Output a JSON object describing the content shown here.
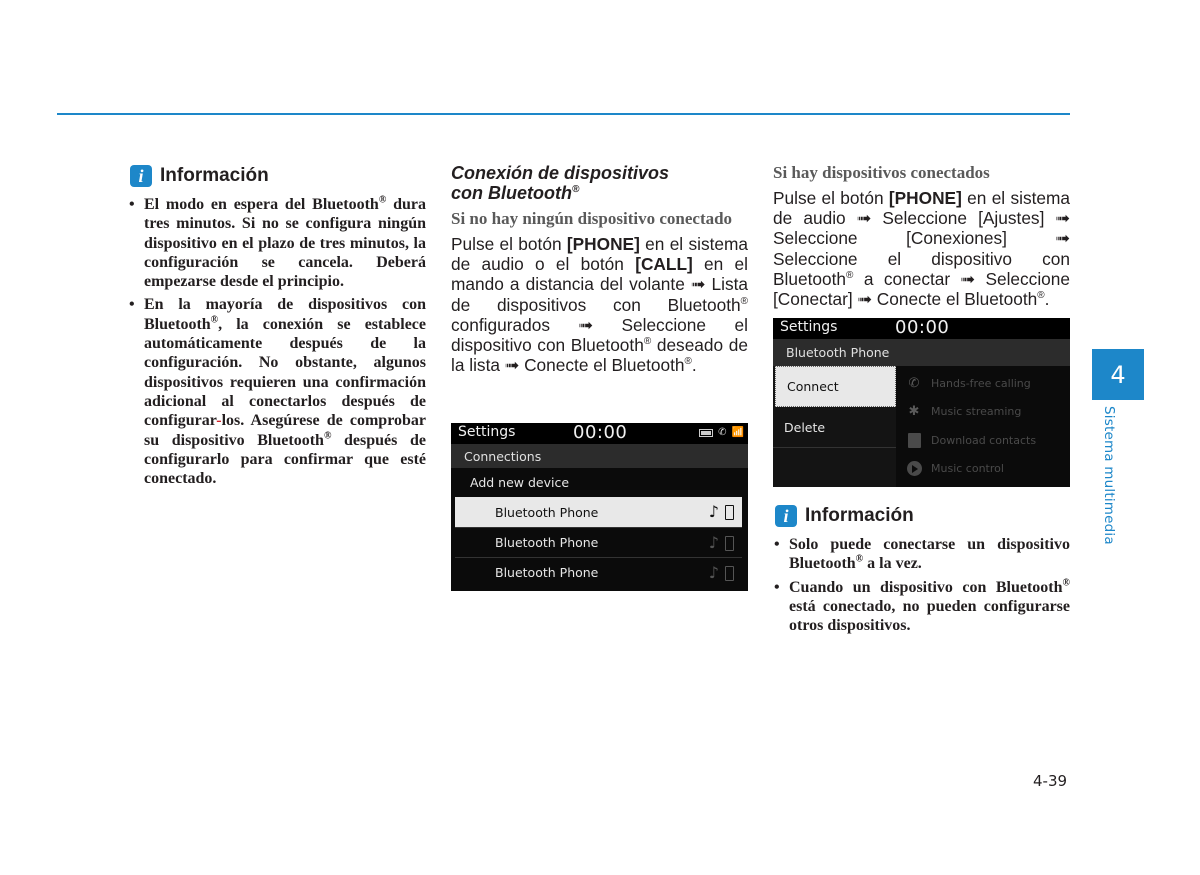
{
  "page": {
    "page_number": "4-39",
    "chapter_number": "4",
    "chapter_title": "Sistema multimedia",
    "accent_color": "#1d87c9"
  },
  "column1": {
    "info_title": "Información",
    "bullets": [
      {
        "parts": [
          "El modo en espera del Bluetooth",
          "®",
          " dura tres minutos. Si no se configura ningún dispositivo en el plazo de tres minutos, la configuración se cancela. Deberá empezarse desde el principio."
        ]
      },
      {
        "parts": [
          "En la mayoría de dispositivos con Bluetooth",
          "®",
          ", la conexión se establece automáticamente después de la configuración. No obstante, algunos dispositivos requieren una confirmación adicional al conectarlos después de configurar",
          "-",
          "los. Asegúrese de comprobar su dispositivo Bluetooth",
          "®",
          " después de configurarlo para confirmar que esté conectado."
        ]
      }
    ]
  },
  "column2": {
    "section_title_line1": "Conexión de dispositivos",
    "section_title_line2": "con Bluetooth",
    "section_title_sup": "®",
    "subtitle": "Si no hay ningún dispositivo conectado",
    "body": {
      "t1": "Pulse el botón ",
      "b1": "[PHONE]",
      "t2": " en el sistema de audio o el botón ",
      "b2": "[CALL]",
      "t3": " en el mando a distancia del volante ➟ Lista de dispositivos con Bluetooth",
      "sup1": "®",
      "t4": " configurados ➟ Seleccione el dispositivo con Bluetooth",
      "sup2": "®",
      "t5": " deseado de la lista ➟ Conecte el Bluetooth",
      "sup3": "®",
      "t6": "."
    },
    "screen": {
      "title": "Settings",
      "clock": "00:00",
      "header": "Connections",
      "add_label": "Add new device",
      "devices": [
        {
          "name": "Bluetooth Phone",
          "selected": true
        },
        {
          "name": "Bluetooth Phone",
          "selected": false
        },
        {
          "name": "Bluetooth Phone",
          "selected": false
        }
      ],
      "status_icons": [
        "battery-icon",
        "call-icon",
        "signal-icon"
      ]
    }
  },
  "column3": {
    "subtitle": "Si hay dispositivos conectados",
    "body": {
      "t1": "Pulse el botón ",
      "b1": "[PHONE]",
      "t2": " en el sistema de audio ➟ Seleccione [Ajustes] ➟ Seleccione [Conexiones] ➟ Seleccione el dispositivo con Bluetooth",
      "sup1": "®",
      "t3": " a conectar ➟ Seleccione [Conectar] ➟ Conecte el Bluetooth",
      "sup2": "®",
      "t4": "."
    },
    "screen": {
      "title": "Settings",
      "clock": "00:00",
      "header": "Bluetooth Phone",
      "menu": [
        "Connect",
        "Delete"
      ],
      "options": [
        "Hands-free calling",
        "Music streaming",
        "Download contacts",
        "Music control"
      ]
    },
    "info_title": "Información",
    "bullets": [
      {
        "parts": [
          "Solo puede conectarse un dispositivo Bluetooth",
          "®",
          " a la vez."
        ]
      },
      {
        "parts": [
          "Cuando un dispositivo con Bluetooth",
          "®",
          " está conectado, no pueden configurarse otros dispositivos."
        ]
      }
    ]
  }
}
